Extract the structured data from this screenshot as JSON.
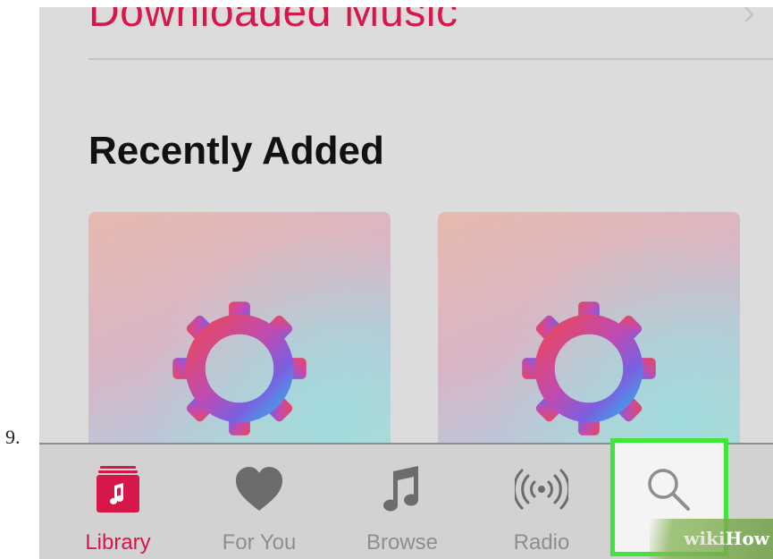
{
  "step_number": "9.",
  "library_list": {
    "downloaded_row_label": "Downloaded Music",
    "chevron_icon": "chevron-right-icon"
  },
  "recently_added": {
    "heading": "Recently Added",
    "albums": [
      {
        "artwork_icon": "gear-icon"
      },
      {
        "artwork_icon": "gear-icon"
      }
    ]
  },
  "tab_bar": {
    "tabs": [
      {
        "label": "Library",
        "icon": "library-icon",
        "active": true
      },
      {
        "label": "For You",
        "icon": "heart-icon",
        "active": false
      },
      {
        "label": "Browse",
        "icon": "music-note-icon",
        "active": false
      },
      {
        "label": "Radio",
        "icon": "radio-broadcast-icon",
        "active": false
      },
      {
        "label": "Search",
        "icon": "search-icon",
        "active": false,
        "highlighted": true
      }
    ]
  },
  "watermark": {
    "wiki": "wiki",
    "how": "How"
  },
  "colors": {
    "accent": "#d6174a",
    "inactive": "#8e8e8e",
    "highlight_border": "#3ee63a"
  }
}
